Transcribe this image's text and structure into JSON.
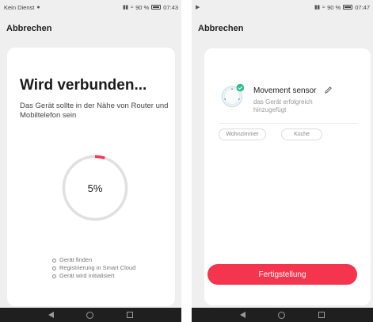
{
  "colors": {
    "accent": "#f5344e",
    "check": "#2dbd8a",
    "track": "#e0e0e0",
    "page_bg": "#efefef",
    "card_bg": "#ffffff"
  },
  "left_screen": {
    "status": {
      "carrier": "Kein Dienst",
      "battery": "90 %",
      "time": "07:43"
    },
    "cancel_label": "Abbrechen",
    "title": "Wird verbunden...",
    "description": "Das Gerät sollte in der Nähe von Router und Mobiltelefon sein",
    "progress": {
      "label": "5%",
      "fraction": 0.05
    },
    "steps": [
      "Gerät finden",
      "Registrierung in Smart Cloud",
      "Gerät wird initialisiert"
    ]
  },
  "right_screen": {
    "status": {
      "battery": "90 %",
      "time": "07:47"
    },
    "cancel_label": "Abbrechen",
    "device": {
      "name": "Movement sensor",
      "status": "das Gerät erfolgreich hinzugefügt",
      "icon": "motion-sensor-icon"
    },
    "rooms": [
      "Wohnzimmer",
      "Küche"
    ],
    "finish_label": "Fertigstellung"
  }
}
